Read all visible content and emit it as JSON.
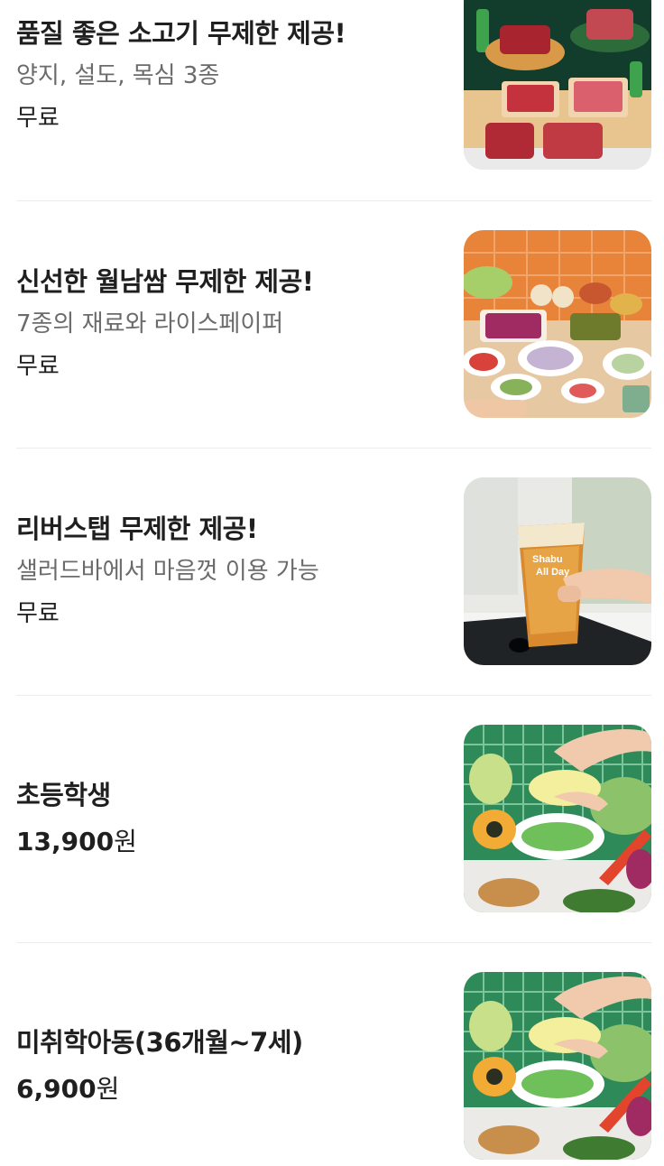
{
  "items": [
    {
      "title": "품질 좋은 소고기 무제한 제공!",
      "description": "양지, 설도, 목심 3종",
      "price": "무료",
      "image": "beef-platters-photo"
    },
    {
      "title": "신선한 월남쌈 무제한 제공!",
      "description": "7종의 재료와 라이스페이퍼",
      "price": "무료",
      "image": "rice-paper-roll-ingredients-photo"
    },
    {
      "title": "리버스탭 무제한 제공!",
      "description": "샐러드바에서 마음껏 이용 가능",
      "price": "무료",
      "image": "beer-glass-reverse-tap-photo"
    },
    {
      "title": "초등학생",
      "price_amount": "13,900",
      "price_unit": "원",
      "image": "vegetables-salad-bar-photo"
    },
    {
      "title": "미취학아동(36개월~7세)",
      "price_amount": "6,900",
      "price_unit": "원",
      "image": "vegetables-salad-bar-photo"
    }
  ],
  "colors": {
    "text_primary": "#1f1f1f",
    "text_secondary": "#6b6b6b",
    "divider": "#ececec",
    "tile_green": "#2f8a5a",
    "tile_orange": "#e8843a"
  }
}
